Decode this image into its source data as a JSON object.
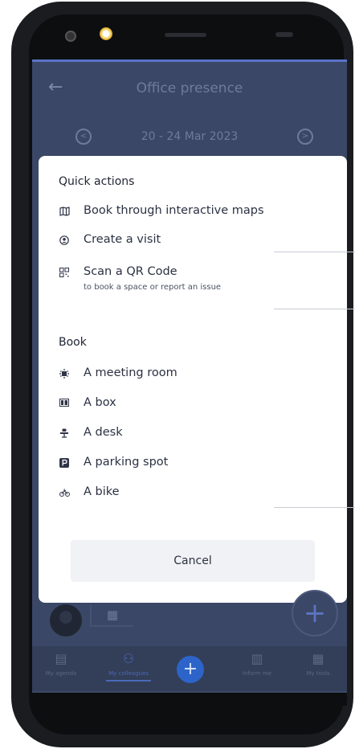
{
  "header": {
    "title": "Office presence"
  },
  "week": {
    "label": "20 - 24 Mar 2023"
  },
  "sheet": {
    "quick_actions_title": "Quick actions",
    "quick_actions": [
      {
        "icon": "map-icon",
        "label": "Book through interactive maps"
      },
      {
        "icon": "visitor-icon",
        "label": "Create a visit"
      },
      {
        "icon": "qr-code-icon",
        "label": "Scan a QR Code",
        "sublabel": "to book a space or report an issue"
      }
    ],
    "book_title": "Book",
    "book_items": [
      {
        "icon": "meeting-room-icon",
        "label": "A meeting room"
      },
      {
        "icon": "box-icon",
        "label": "A box"
      },
      {
        "icon": "desk-icon",
        "label": "A desk"
      },
      {
        "icon": "parking-icon",
        "label": "A parking spot"
      },
      {
        "icon": "bike-icon",
        "label": "A bike"
      }
    ],
    "cancel_label": "Cancel"
  },
  "tabbar": {
    "tabs": [
      {
        "icon": "calendar-icon",
        "label": "My agenda"
      },
      {
        "icon": "colleagues-icon",
        "label": "My colleagues",
        "active": true
      },
      {
        "icon": "building-icon",
        "label": "Inform me"
      },
      {
        "icon": "grid-icon",
        "label": "My tools"
      }
    ]
  },
  "colors": {
    "accent": "#2c64c9",
    "overlay": "#3b4766",
    "sheet": "#ffffff"
  }
}
